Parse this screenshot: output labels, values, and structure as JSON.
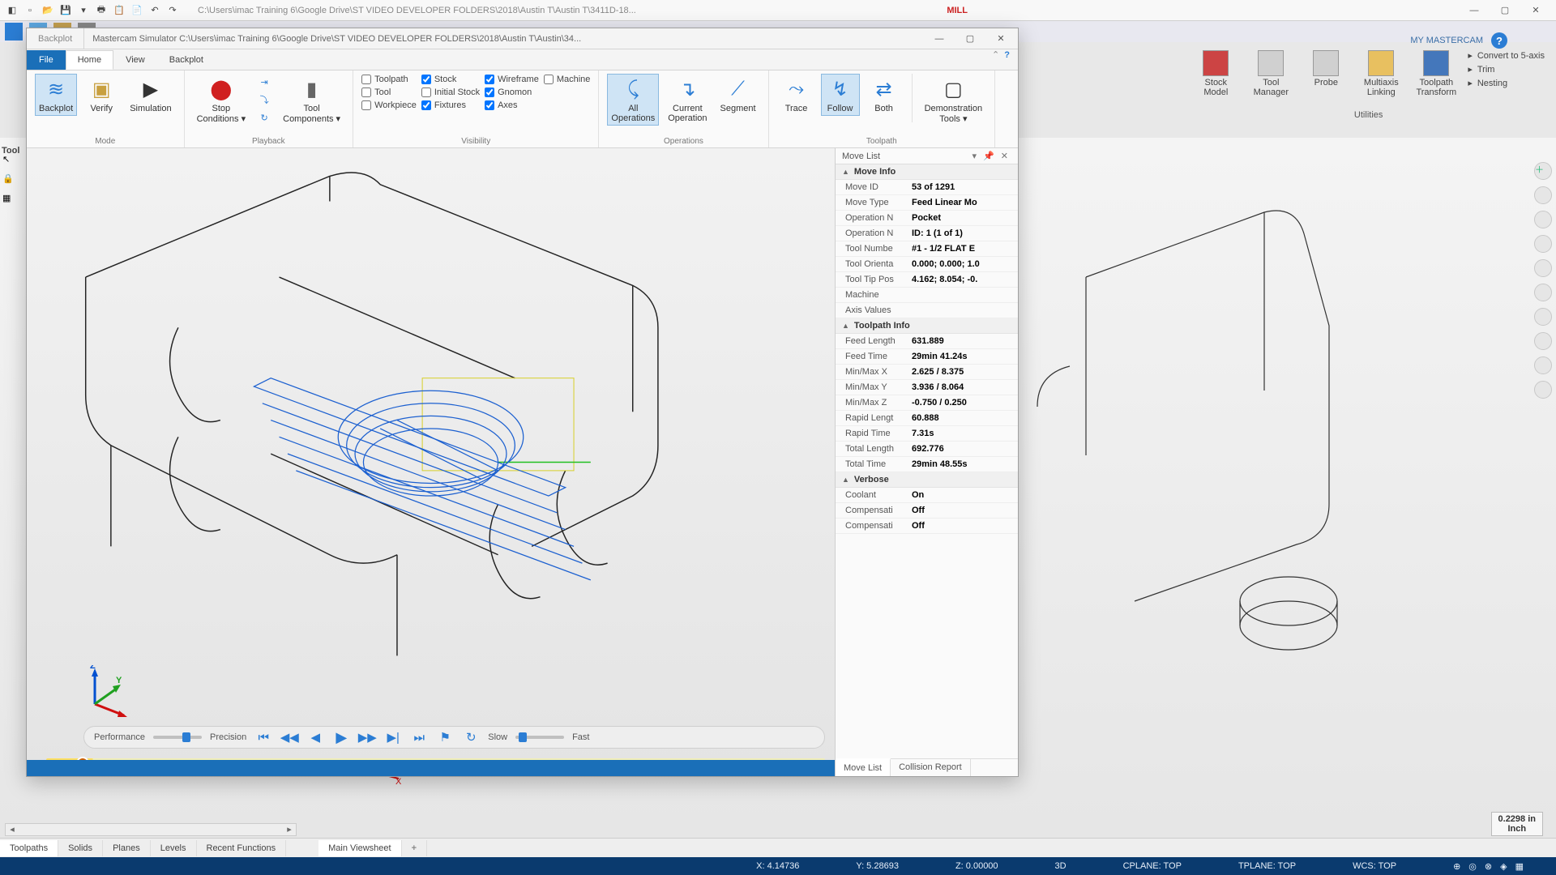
{
  "titlebar": {
    "path": "C:\\Users\\imac Training 6\\Google Drive\\ST VIDEO DEVELOPER FOLDERS\\2018\\Austin T\\Austin T\\3411D-18...",
    "app_name": "MILL"
  },
  "top_right": {
    "my": "MY MASTERCAM"
  },
  "utilities": {
    "stock_model": "Stock\nModel",
    "tool_mgr": "Tool\nManager",
    "probe": "Probe",
    "multiaxis": "Multiaxis\nLinking",
    "toolpath_trans": "Toolpath\nTransform",
    "convert": "Convert to 5-axis",
    "trim": "Trim",
    "nesting": "Nesting",
    "group": "Utilities"
  },
  "simwin": {
    "label": "Backplot",
    "path": "Mastercam Simulator   C:\\Users\\imac Training 6\\Google Drive\\ST VIDEO DEVELOPER FOLDERS\\2018\\Austin T\\Austin\\34..."
  },
  "tabs": {
    "file": "File",
    "home": "Home",
    "view": "View",
    "backplot": "Backplot"
  },
  "ribbon": {
    "mode": {
      "backplot": "Backplot",
      "verify": "Verify",
      "simulation": "Simulation",
      "group": "Mode"
    },
    "playback": {
      "stop": "Stop\nConditions ▾",
      "tool": "Tool\nComponents ▾",
      "group": "Playback"
    },
    "visibility": {
      "toolpath": "Toolpath",
      "tool": "Tool",
      "workpiece": "Workpiece",
      "stock": "Stock",
      "initial_stock": "Initial Stock",
      "fixtures": "Fixtures",
      "wireframe": "Wireframe",
      "gnomon": "Gnomon",
      "axes": "Axes",
      "machine": "Machine",
      "group": "Visibility"
    },
    "operations": {
      "all": "All\nOperations",
      "current": "Current\nOperation",
      "segment": "Segment",
      "group": "Operations"
    },
    "toolpath": {
      "trace": "Trace",
      "follow": "Follow",
      "both": "Both",
      "demo": "Demonstration\nTools ▾",
      "group": "Toolpath"
    }
  },
  "panel": {
    "title": "Move List",
    "move_info": "Move Info",
    "toolpath_info": "Toolpath Info",
    "verbose": "Verbose",
    "rows": {
      "move_id_k": "Move ID",
      "move_id_v": "53 of 1291",
      "move_type_k": "Move Type",
      "move_type_v": "Feed Linear Mo",
      "op_name_k": "Operation N",
      "op_name_v": "Pocket",
      "op_num_k": "Operation N",
      "op_num_v": "ID: 1 (1 of 1)",
      "tool_num_k": "Tool Numbe",
      "tool_num_v": "#1 -  1/2 FLAT E",
      "tool_ori_k": "Tool Orienta",
      "tool_ori_v": "0.000; 0.000; 1.0",
      "tool_tip_k": "Tool Tip Pos",
      "tool_tip_v": "4.162; 8.054; -0.",
      "machine_k": "Machine",
      "machine_v": "",
      "axis_k": "Axis Values",
      "axis_v": "",
      "feed_len_k": "Feed Length",
      "feed_len_v": "631.889",
      "feed_time_k": "Feed Time",
      "feed_time_v": "29min 41.24s",
      "mmx_k": "Min/Max X",
      "mmx_v": "2.625 / 8.375",
      "mmy_k": "Min/Max Y",
      "mmy_v": "3.936 / 8.064",
      "mmz_k": "Min/Max Z",
      "mmz_v": "-0.750 / 0.250",
      "rapid_len_k": "Rapid Lengt",
      "rapid_len_v": "60.888",
      "rapid_time_k": "Rapid Time",
      "rapid_time_v": "7.31s",
      "total_len_k": "Total Length",
      "total_len_v": "692.776",
      "total_time_k": "Total Time",
      "total_time_v": "29min 48.55s",
      "coolant_k": "Coolant",
      "coolant_v": "On",
      "comp1_k": "Compensati",
      "comp1_v": "Off",
      "comp2_k": "Compensati",
      "comp2_v": "Off"
    },
    "tab_move": "Move List",
    "tab_collision": "Collision Report"
  },
  "playbar": {
    "performance": "Performance",
    "precision": "Precision",
    "slow": "Slow",
    "fast": "Fast"
  },
  "bottom_tabs": {
    "toolpaths": "Toolpaths",
    "solids": "Solids",
    "planes": "Planes",
    "levels": "Levels",
    "recent": "Recent Functions",
    "main_view": "Main Viewsheet"
  },
  "status": {
    "x": "X:   4.14736",
    "y": "Y:   5.28693",
    "z": "Z:   0.00000",
    "3d": "3D",
    "cplane": "CPLANE: TOP",
    "tplane": "TPLANE: TOP",
    "wcs": "WCS: TOP"
  },
  "scale": {
    "val": "0.2298 in",
    "unit": "Inch"
  },
  "left_sidebar_label": "Tool"
}
